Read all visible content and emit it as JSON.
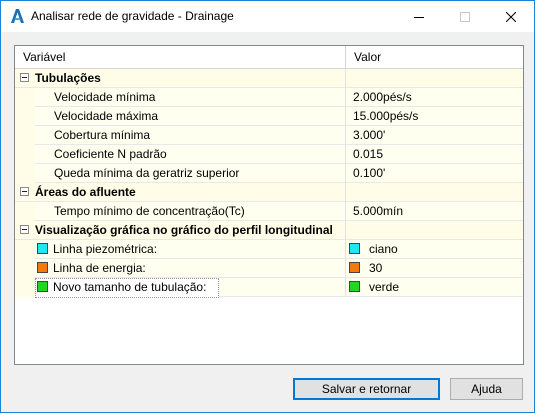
{
  "window": {
    "title": "Analisar rede de gravidade - Drainage",
    "app_icon": "autocad-a-icon",
    "controls": {
      "minimize": "minimize-icon",
      "maximize": "maximize-icon",
      "close": "close-icon"
    }
  },
  "grid": {
    "columns": {
      "variable": "Variável",
      "value": "Valor"
    },
    "categories": [
      {
        "label": "Tubulações",
        "expanded": true,
        "rows": [
          {
            "label": "Velocidade mínima",
            "value": "2.000pés/s"
          },
          {
            "label": "Velocidade máxima",
            "value": "15.000pés/s"
          },
          {
            "label": "Cobertura mínima",
            "value": "3.000'"
          },
          {
            "label": "Coeficiente N padrão",
            "value": "0.015"
          },
          {
            "label": "Queda mínima da geratriz superior",
            "value": "0.100'"
          }
        ]
      },
      {
        "label": "Áreas do afluente",
        "expanded": true,
        "rows": [
          {
            "label": "Tempo mínimo de concentração(Tc)",
            "value": "5.000mín"
          }
        ]
      },
      {
        "label": "Visualização gráfica no gráfico do perfil longitudinal",
        "expanded": true,
        "rows": [
          {
            "label": "Linha piezométrica:",
            "value": "ciano",
            "color": "#1ee8f0"
          },
          {
            "label": "Linha de energia:",
            "value": "30",
            "color": "#f07a10"
          },
          {
            "label": "Novo tamanho de tubulação:",
            "value": "verde",
            "color": "#22d624"
          }
        ]
      }
    ]
  },
  "buttons": {
    "save": "Salvar e retornar",
    "help": "Ajuda"
  },
  "colors": {
    "category_bg": "#fffce8",
    "window_border": "#1883d7",
    "default_button_border": "#0078d7"
  }
}
